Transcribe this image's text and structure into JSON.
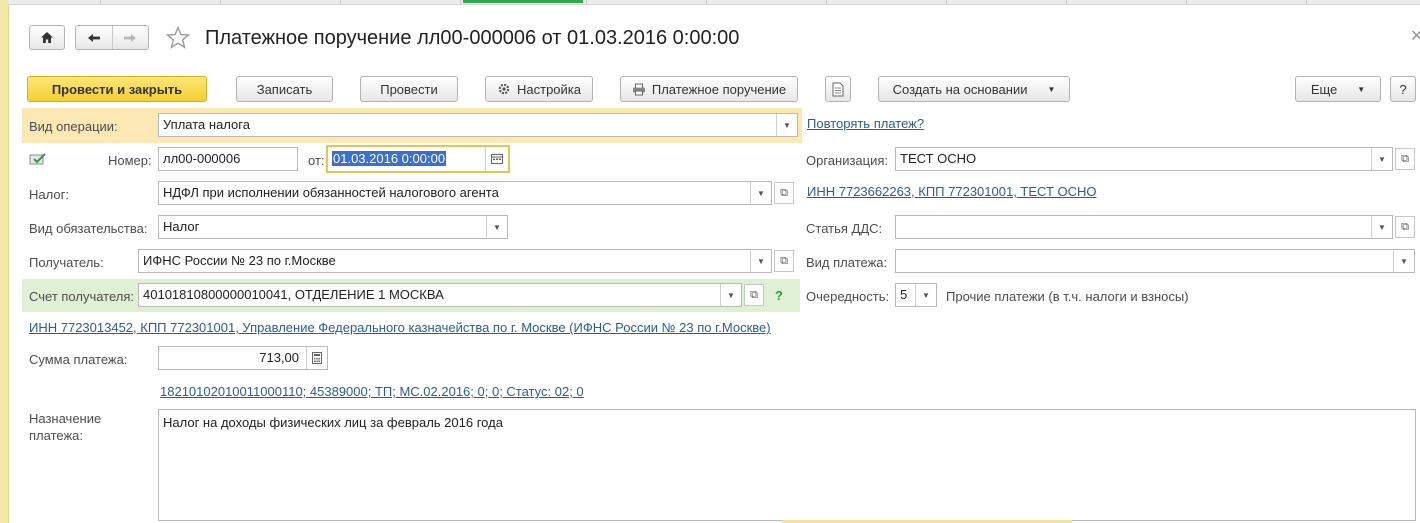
{
  "window": {
    "title": "Платежное поручение лл00-000006 от 01.03.2016 0:00:00"
  },
  "toolbar": {
    "post_close": "Провести и закрыть",
    "save": "Записать",
    "post": "Провести",
    "settings": "Настройка",
    "print": "Платежное поручение",
    "create_based": "Создать на основании",
    "more": "Еще",
    "help": "?"
  },
  "form": {
    "operation_type": {
      "label": "Вид операции:",
      "value": "Уплата налога"
    },
    "repeat_link": "Повторять платеж?",
    "number": {
      "label": "Номер:",
      "value": "лл00-000006"
    },
    "date": {
      "label": "от:",
      "value": "01.03.2016  0:00:00"
    },
    "organization": {
      "label": "Организация:",
      "value": "ТЕСТ ОСНО"
    },
    "org_details_link": "ИНН 7723662263, КПП 772301001, ТЕСТ ОСНО",
    "tax": {
      "label": "Налог:",
      "value": "НДФЛ при исполнении обязанностей налогового агента"
    },
    "dds": {
      "label": "Статья ДДС:",
      "value": ""
    },
    "obligation": {
      "label": "Вид обязательства:",
      "value": "Налог"
    },
    "recipient": {
      "label": "Получатель:",
      "value": "ИФНС России № 23 по г.Москве"
    },
    "payment_kind": {
      "label": "Вид платежа:",
      "value": ""
    },
    "recipient_account": {
      "label": "Счет получателя:",
      "value": "40101810800000010041, ОТДЕЛЕНИЕ 1 МОСКВА",
      "help": "?"
    },
    "priority": {
      "label": "Очередность:",
      "value": "5",
      "description": "Прочие платежи (в т.ч. налоги и взносы)"
    },
    "recipient_details_link": "ИНН 7723013452, КПП 772301001, Управление Федерального казначейства по г. Москве (ИФНС России № 23 по г.Москве)",
    "amount": {
      "label": "Сумма платежа:",
      "value": "713,00"
    },
    "kbk_link": "18210102010011000110; 45389000; ТП; МС.02.2016; 0; 0; Статус: 02; 0",
    "purpose": {
      "label_line1": "Назначение",
      "label_line2": "платежа:",
      "value": "Налог на доходы физических лиц за февраль 2016 года"
    }
  }
}
